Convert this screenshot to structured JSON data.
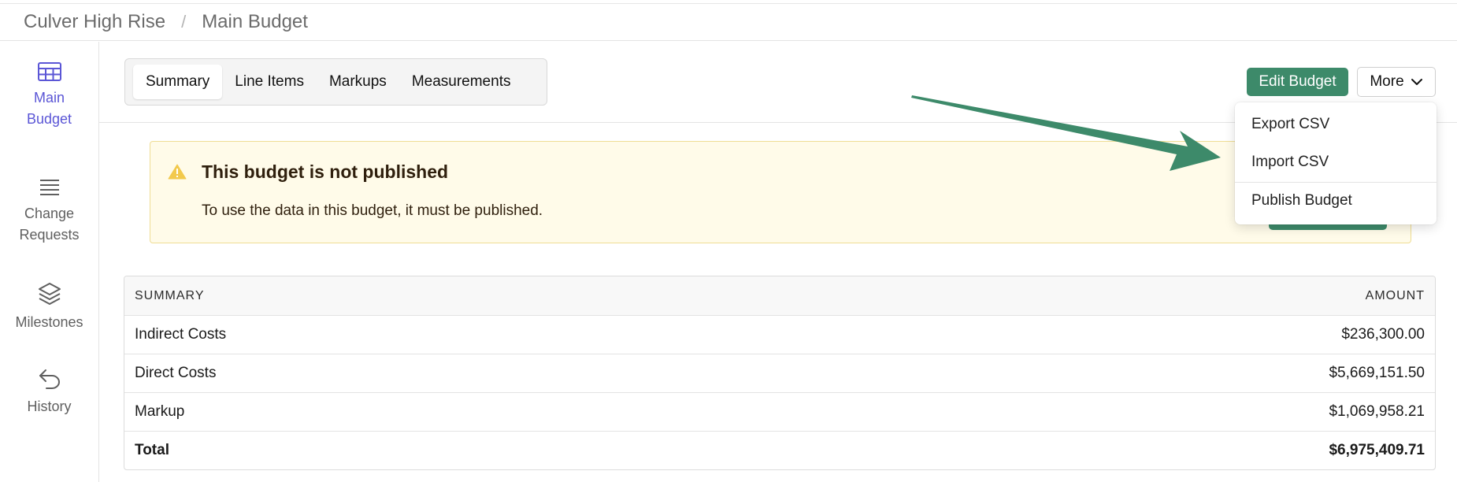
{
  "breadcrumb": {
    "project": "Culver High Rise",
    "separator": "/",
    "page": "Main Budget"
  },
  "sidebar": {
    "items": [
      {
        "label": "Main\nBudget",
        "icon": "table-icon",
        "active": true
      },
      {
        "label": "Change\nRequests",
        "icon": "list-icon",
        "active": false
      },
      {
        "label": "Milestones",
        "icon": "layers-icon",
        "active": false
      },
      {
        "label": "History",
        "icon": "undo-arrow-icon",
        "active": false
      }
    ]
  },
  "tabs": [
    {
      "label": "Summary",
      "active": true
    },
    {
      "label": "Line Items",
      "active": false
    },
    {
      "label": "Markups",
      "active": false
    },
    {
      "label": "Measurements",
      "active": false
    }
  ],
  "toolbar": {
    "edit_label": "Edit Budget",
    "more_label": "More"
  },
  "alert": {
    "title": "This budget is not published",
    "text": "To use the data in this budget, it must be published."
  },
  "menu": {
    "items": [
      "Export CSV",
      "Import CSV",
      "Publish Budget"
    ]
  },
  "table": {
    "headers": [
      "SUMMARY",
      "AMOUNT"
    ],
    "rows": [
      {
        "label": "Indirect Costs",
        "amount": "$236,300.00"
      },
      {
        "label": "Direct Costs",
        "amount": "$5,669,151.50"
      },
      {
        "label": "Markup",
        "amount": "$1,069,958.21"
      },
      {
        "label": "Total",
        "amount": "$6,975,409.71"
      }
    ]
  },
  "colors": {
    "accent": "#5b56d6",
    "primary_button": "#3d8a6a",
    "annotation_arrow": "#3d8a6a",
    "alert_background": "#fffbe9",
    "alert_border": "#efdd94",
    "warning_icon": "#f2c94c"
  }
}
